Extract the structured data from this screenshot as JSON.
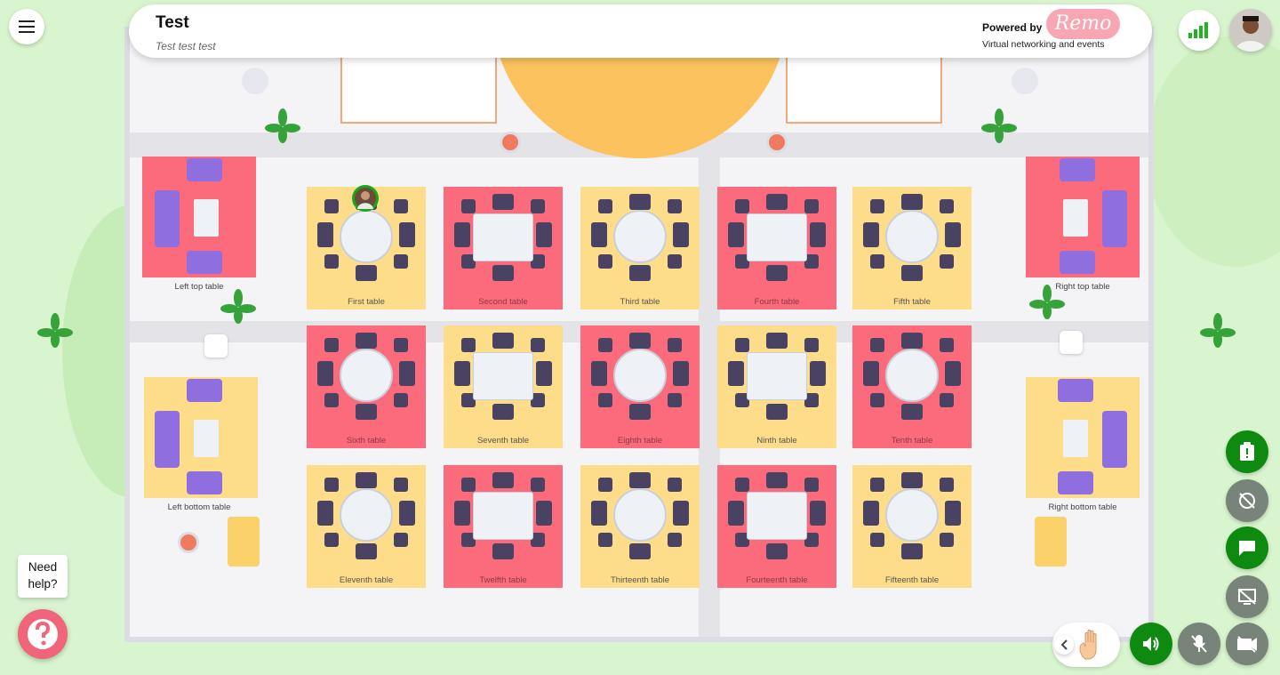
{
  "header": {
    "title": "Test",
    "subtitle": "Test test test",
    "powered_by": "Powered by",
    "brand": "Remo",
    "tagline": "Virtual networking and events"
  },
  "colors": {
    "accent_green": "#0f8a10",
    "control_grey": "#78837a",
    "table_yellow": "#fddd8a",
    "table_pink": "#fc6b7c",
    "brand_pink": "#f8a6b4",
    "help_red": "#f0657a"
  },
  "lounges": {
    "left_top": "Left top table",
    "right_top": "Right top table",
    "left_bottom": "Left bottom table",
    "right_bottom": "Right bottom table"
  },
  "tables": [
    {
      "label": "First table",
      "color": "yellow",
      "desk": "round"
    },
    {
      "label": "Second table",
      "color": "pink",
      "desk": "square"
    },
    {
      "label": "Third table",
      "color": "yellow",
      "desk": "round"
    },
    {
      "label": "Fourth table",
      "color": "pink",
      "desk": "square"
    },
    {
      "label": "Fifth table",
      "color": "yellow",
      "desk": "round"
    },
    {
      "label": "Sixth table",
      "color": "pink",
      "desk": "round"
    },
    {
      "label": "Seventh table",
      "color": "yellow",
      "desk": "square"
    },
    {
      "label": "Eighth table",
      "color": "pink",
      "desk": "round"
    },
    {
      "label": "Ninth table",
      "color": "yellow",
      "desk": "square"
    },
    {
      "label": "Tenth table",
      "color": "pink",
      "desk": "round"
    },
    {
      "label": "Eleventh table",
      "color": "yellow",
      "desk": "round"
    },
    {
      "label": "Twelfth table",
      "color": "pink",
      "desk": "square"
    },
    {
      "label": "Thirteenth table",
      "color": "yellow",
      "desk": "round"
    },
    {
      "label": "Fourteenth table",
      "color": "pink",
      "desk": "square"
    },
    {
      "label": "Fifteenth table",
      "color": "yellow",
      "desk": "round"
    }
  ],
  "help": {
    "line1": "Need",
    "line2": "help?"
  },
  "icons": {
    "menu": "hamburger-menu-icon",
    "signal": "signal-strength-icon",
    "clipboard": "clipboard-alert-icon",
    "camera_off": "camera-off-icon",
    "chat": "chat-icon",
    "screen_share_off": "screen-share-off-icon",
    "speaker": "speaker-icon",
    "mic_off": "mic-off-icon",
    "video_off": "video-off-icon",
    "raise_hand": "raise-hand-icon",
    "collapse": "chevron-left-icon",
    "help": "question-mark-icon"
  }
}
